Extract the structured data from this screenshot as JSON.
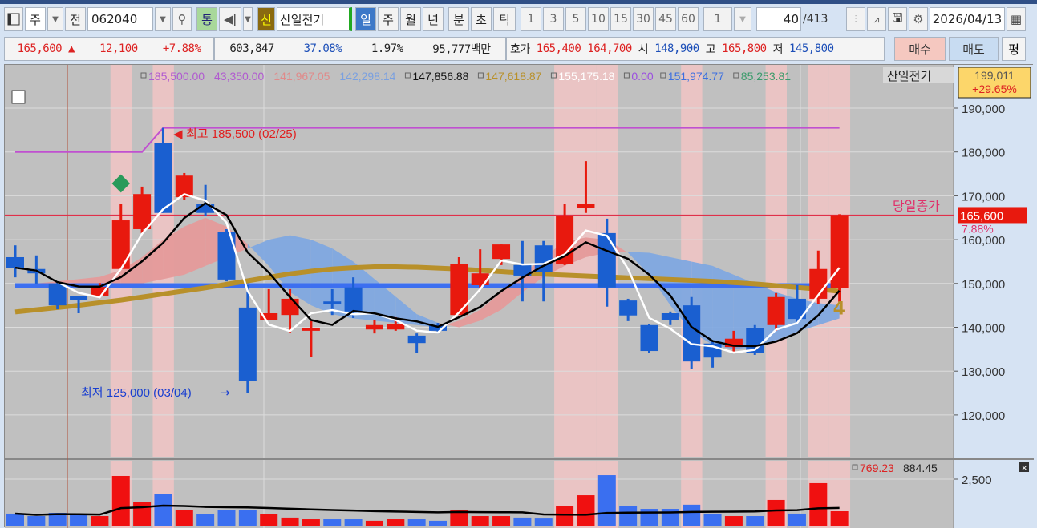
{
  "toolbar": {
    "layout_icon": "layout-icon",
    "market": "주",
    "prev": "전",
    "code": "062040",
    "tong": "통",
    "shin": "신",
    "stock_name": "산일전기",
    "periods": [
      "일",
      "주",
      "월",
      "년",
      "분",
      "초",
      "틱"
    ],
    "active_period": "일",
    "intervals": [
      "1",
      "3",
      "5",
      "10",
      "15",
      "30",
      "45",
      "60"
    ],
    "multiplier": "1",
    "count": "40",
    "total": "/413",
    "date": "2026/04/13"
  },
  "quote": {
    "price": "165,600",
    "arrow": "▲",
    "change": "12,100",
    "change_pct": "+7.88%",
    "volume": "603,847",
    "turnover_pct": "37.08%",
    "ratio": "1.97%",
    "amount": "95,777백만",
    "hoga_label": "호가",
    "ask": "165,400",
    "bid": "164,700",
    "open_label": "시",
    "open": "148,900",
    "high_label": "고",
    "high": "165,800",
    "low_label": "저",
    "low": "145,800",
    "buy": "매수",
    "sell": "매도",
    "eval": "평"
  },
  "legend": {
    "items": [
      {
        "text": "185,500.00",
        "color": "#b05ad0"
      },
      {
        "text": "43,350.00",
        "color": "#b05ad0"
      },
      {
        "text": "141,967.05",
        "color": "#e08a8a"
      },
      {
        "text": "142,298.14",
        "color": "#7aa0e0"
      },
      {
        "text": "147,856.88",
        "color": "#111111"
      },
      {
        "text": "147,618.87",
        "color": "#b8902a"
      },
      {
        "text": "155,175.18",
        "color": "#ffffff"
      },
      {
        "text": "0.00",
        "color": "#9b4fe0"
      },
      {
        "text": "151,974.77",
        "color": "#3c6fe0"
      },
      {
        "text": "85,253.81",
        "color": "#3a9a6a"
      }
    ],
    "name": "산일전기"
  },
  "top_box": {
    "value": "199,011",
    "pct": "+29.65%"
  },
  "labels": {
    "high": "최고 185,500 (02/25)",
    "low": "최저 125,000 (03/04)",
    "close_line": "당일종가",
    "close_value": "165,600",
    "close_pct": "7.88%",
    "vol_legend_a": "769.23",
    "vol_legend_b": "884.45"
  },
  "chart_data": {
    "type": "candlestick",
    "ylim": [
      112000,
      198000
    ],
    "yticks": [
      "190,000",
      "180,000",
      "170,000",
      "160,000",
      "150,000",
      "140,000",
      "130,000",
      "120,000"
    ],
    "ytick_values": [
      190000,
      180000,
      170000,
      160000,
      150000,
      140000,
      130000,
      120000
    ],
    "vol_tick": "2,500",
    "vol_tick_value": 2500,
    "current_price": 165600,
    "highlight_days": [
      5,
      7,
      26,
      27,
      28,
      32,
      36,
      38,
      39
    ],
    "candles": [
      [
        156000,
        153600,
        158700,
        151400
      ],
      [
        153300,
        152300,
        156400,
        150000
      ],
      [
        150000,
        145000,
        150500,
        144100
      ],
      [
        147200,
        146300,
        147200,
        143200
      ],
      [
        147200,
        149200,
        150100,
        146900
      ],
      [
        153300,
        164400,
        168200,
        153300
      ],
      [
        162400,
        170400,
        172100,
        161500
      ],
      [
        182100,
        166100,
        185500,
        166100
      ],
      [
        169700,
        174600,
        175200,
        169000
      ],
      [
        168200,
        166100,
        172500,
        165500
      ],
      [
        161800,
        150900,
        162400,
        150500
      ],
      [
        144500,
        127700,
        149600,
        125000
      ],
      [
        141700,
        143200,
        148700,
        141700
      ],
      [
        142800,
        146500,
        148700,
        138800
      ],
      [
        139200,
        139900,
        141400,
        133300
      ],
      [
        145900,
        145400,
        148700,
        142800
      ],
      [
        149100,
        143600,
        151400,
        142100
      ],
      [
        139500,
        140500,
        141700,
        138600
      ],
      [
        139500,
        140800,
        142300,
        139200
      ],
      [
        138100,
        136400,
        138600,
        134100
      ],
      [
        140500,
        139200,
        141000,
        138600
      ],
      [
        142800,
        154500,
        156000,
        142800
      ],
      [
        149600,
        152300,
        157800,
        149100
      ],
      [
        155600,
        158900,
        158900,
        154200
      ],
      [
        154200,
        151800,
        159700,
        145900
      ],
      [
        158700,
        152700,
        159700,
        145900
      ],
      [
        154500,
        165500,
        168200,
        154200
      ],
      [
        167300,
        168100,
        177900,
        166100
      ],
      [
        161500,
        149100,
        164800,
        144700
      ],
      [
        146100,
        142700,
        146500,
        141400
      ],
      [
        140500,
        134600,
        140800,
        134100
      ],
      [
        143200,
        141700,
        143600,
        140500
      ],
      [
        145000,
        132200,
        146900,
        130400
      ],
      [
        136300,
        133100,
        136800,
        130800
      ],
      [
        135500,
        137400,
        139200,
        134100
      ],
      [
        139900,
        134100,
        140500,
        133700
      ],
      [
        140500,
        146900,
        147800,
        139200
      ],
      [
        146500,
        141900,
        149600,
        141000
      ],
      [
        146500,
        153300,
        157500,
        145400
      ],
      [
        148900,
        165600,
        165800,
        145800
      ]
    ],
    "volume": [
      680,
      550,
      720,
      640,
      550,
      2670,
      1310,
      1700,
      890,
      640,
      850,
      850,
      640,
      470,
      380,
      380,
      380,
      300,
      380,
      380,
      300,
      890,
      550,
      550,
      470,
      420,
      1060,
      1650,
      2710,
      1060,
      930,
      930,
      1150,
      680,
      550,
      550,
      1400,
      680,
      2290,
      805
    ],
    "gold_ma": [
      143500,
      144000,
      144500,
      145000,
      145600,
      146200,
      146900,
      147600,
      148300,
      149000,
      149800,
      150600,
      151400,
      152200,
      152800,
      153300,
      153600,
      153800,
      153800,
      153700,
      153500,
      153300,
      153000,
      152700,
      152400,
      152100,
      151900,
      151700,
      151500,
      151300,
      151100,
      150900,
      150700,
      150500,
      150200,
      149900,
      149500,
      149100,
      148700,
      148200
    ],
    "blue_ma": 149500,
    "max_line": [
      180000,
      180000,
      180000,
      180000,
      180000,
      180000,
      180000,
      185500
    ],
    "span_a": [
      150000,
      150000,
      150500,
      151000,
      151500,
      153000,
      156000,
      160000,
      163000,
      165000,
      163000,
      159000,
      154000,
      148000,
      145000,
      143000,
      142000,
      141500,
      141000,
      140500,
      140000,
      141500,
      144000,
      148000,
      152000,
      156000,
      159500,
      160500,
      160000,
      157000,
      152000,
      145000,
      139000,
      136000,
      135000,
      135500,
      137000,
      139000,
      140500,
      142000
    ],
    "span_b": [
      149500,
      149500,
      149300,
      149200,
      149000,
      149000,
      150000,
      151000,
      152000,
      154000,
      156000,
      158000,
      160000,
      161000,
      160000,
      158000,
      155000,
      151000,
      147000,
      143000,
      141000,
      140000,
      141500,
      144000,
      148000,
      151500,
      154000,
      156000,
      157000,
      157200,
      157000,
      156000,
      155000,
      154000,
      152000,
      150000,
      148000,
      146500,
      145500,
      145000
    ]
  }
}
